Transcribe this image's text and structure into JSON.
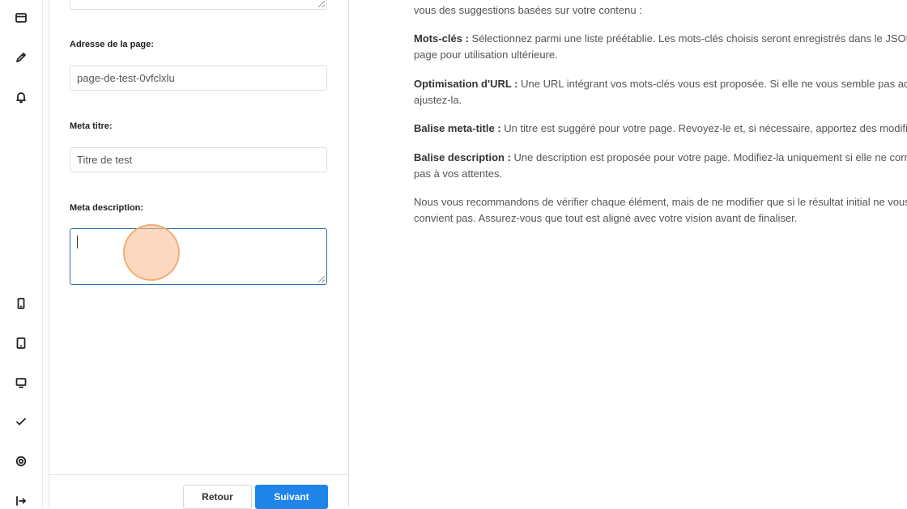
{
  "rail": {
    "icons": [
      "layout-icon",
      "pencil-icon",
      "bell-icon",
      "mobile-icon",
      "tablet-icon",
      "desktop-icon",
      "check-icon",
      "gear-icon",
      "logout-icon"
    ]
  },
  "form": {
    "page_address": {
      "label": "Adresse de la page:",
      "value": "page-de-test-0vfclxlu"
    },
    "meta_title": {
      "label": "Meta titre:",
      "value": "Titre de test"
    },
    "meta_description": {
      "label": "Meta description:",
      "value": ""
    },
    "buttons": {
      "back": "Retour",
      "next": "Suivant"
    }
  },
  "info": {
    "intro_tail": "vous des suggestions basées sur votre contenu :",
    "keywords": {
      "title": "Mots-clés :",
      "line1": " Sélectionnez parmi une liste préétablie. Les mots-clés choisis seront enregistrés dans le JSON d",
      "line2": "page pour utilisation ultérieure."
    },
    "url": {
      "title": "Optimisation d'URL :",
      "line1": " Une URL intégrant vos mots-clés vous est proposée. Si elle ne vous semble pas adé",
      "line2": "ajustez-la."
    },
    "meta_title": {
      "title": "Balise meta-title :",
      "line1": " Un titre est suggéré pour votre page. Revoyez-le et, si nécessaire, apportez des modific"
    },
    "description": {
      "title": "Balise description :",
      "line1": " Une description est proposée pour votre page. Modifiez-la uniquement si elle ne corre",
      "line2": "pas à vos attentes."
    },
    "closing": {
      "line1": "Nous vous recommandons de vérifier chaque élément, mais de ne modifier que si le résultat initial ne vous",
      "line2": "convient pas. Assurez-vous que tout est aligné avec votre vision avant de finaliser."
    }
  },
  "colors": {
    "primary": "#1f84e8",
    "focus": "#2a6fb0",
    "click_marker": "#f8c49c"
  }
}
